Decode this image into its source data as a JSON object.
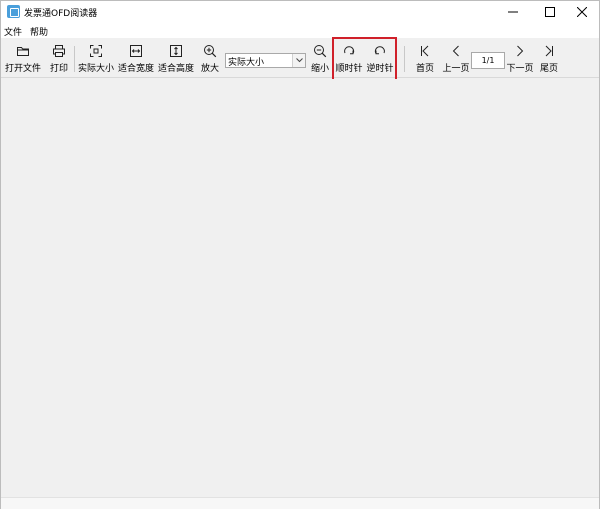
{
  "window": {
    "title": "发票通OFD阅读器"
  },
  "menu": {
    "items": [
      "文件",
      "帮助"
    ]
  },
  "toolbar": {
    "open_label": "打开文件",
    "print_label": "打印",
    "actual_size_label": "实际大小",
    "fit_width_label": "适合宽度",
    "fit_height_label": "适合高度",
    "zoom_in_label": "放大",
    "zoom_select_value": "实际大小",
    "zoom_out_label": "缩小",
    "rotate_cw_label": "顺时针",
    "rotate_ccw_label": "逆时针",
    "first_page_label": "首页",
    "prev_page_label": "上一页",
    "page_indicator": "1/1",
    "next_page_label": "下一页",
    "last_page_label": "尾页"
  },
  "colors": {
    "highlight": "#d0202a",
    "app_icon": "#4a9fdb"
  }
}
